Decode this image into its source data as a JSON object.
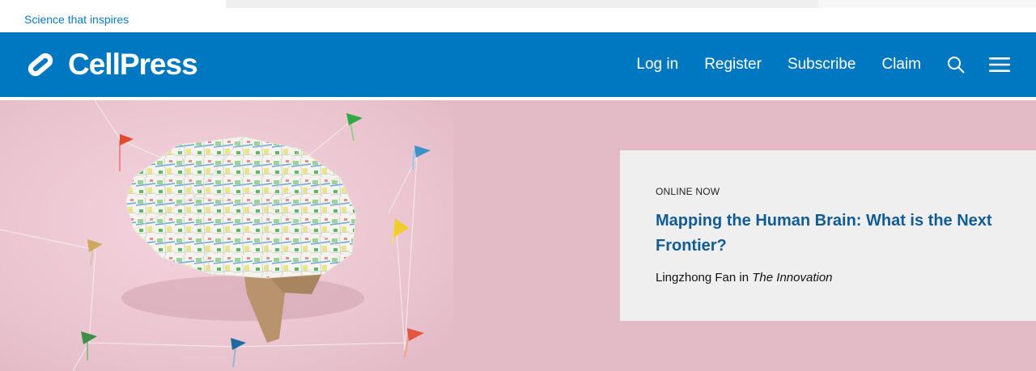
{
  "top": {
    "tagline": "Science that inspires"
  },
  "header": {
    "brand": "CellPress",
    "nav": [
      "Log in",
      "Register",
      "Subscribe",
      "Claim"
    ],
    "search_icon": "search-icon",
    "menu_icon": "hamburger-menu-icon"
  },
  "hero": {
    "image": "paper-brain-map-with-pin-flags",
    "card": {
      "eyebrow": "ONLINE NOW",
      "title": "Mapping the Human Brain: What is the Next Frontier?",
      "author": "Lingzhong Fan",
      "in_word": " in ",
      "journal": "The Innovation"
    }
  },
  "colors": {
    "brand_blue": "#0078c1",
    "hero_bg": "#e3bbc6",
    "card_bg": "#efefef",
    "title_blue": "#125c95"
  }
}
